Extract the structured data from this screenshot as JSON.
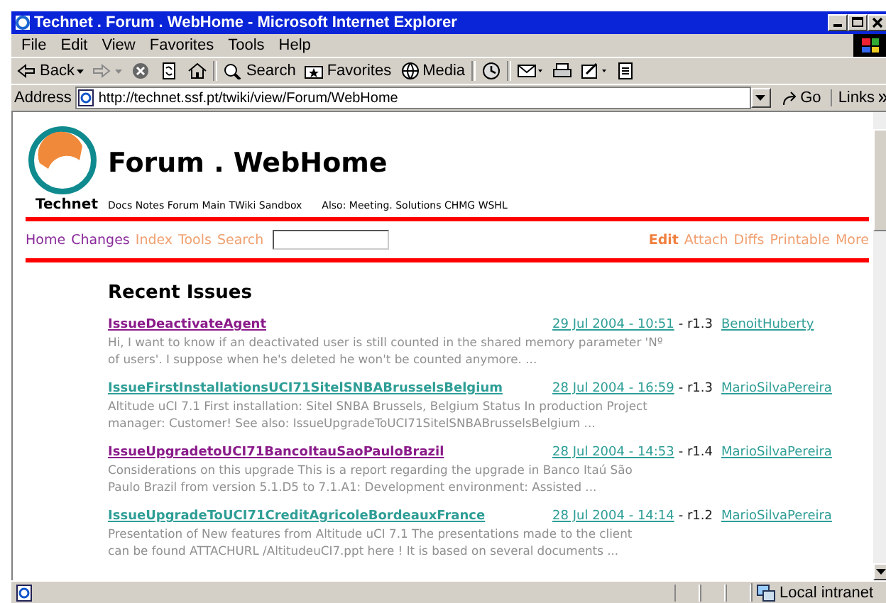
{
  "window": {
    "title": "Technet . Forum . WebHome - Microsoft Internet Explorer"
  },
  "menu": [
    "File",
    "Edit",
    "View",
    "Favorites",
    "Tools",
    "Help"
  ],
  "toolbar": [
    {
      "kind": "back",
      "label": "Back"
    },
    {
      "kind": "forward"
    },
    {
      "kind": "stop"
    },
    {
      "kind": "refresh"
    },
    {
      "kind": "home"
    },
    {
      "kind": "search",
      "label": "Search"
    },
    {
      "kind": "favorites",
      "label": "Favorites"
    },
    {
      "kind": "media",
      "label": "Media"
    },
    {
      "kind": "history"
    },
    {
      "kind": "mail"
    },
    {
      "kind": "print"
    },
    {
      "kind": "edit"
    },
    {
      "kind": "discuss"
    }
  ],
  "address_bar": {
    "label": "Address",
    "value": "http://technet.ssf.pt/twiki/view/Forum/WebHome",
    "go": "Go",
    "links": "Links"
  },
  "page": {
    "site": "Technet",
    "title": "Forum . WebHome",
    "webs": "Docs Notes Forum Main TWiki Sandbox",
    "also": "Also: Meeting. Solutions CHMG WSHL",
    "nav_left": [
      {
        "label": "Home",
        "visited": true
      },
      {
        "label": "Changes",
        "visited": true
      },
      {
        "label": "Index",
        "visited": false
      },
      {
        "label": "Tools",
        "visited": false
      },
      {
        "label": "Search",
        "visited": false
      }
    ],
    "nav_right": [
      {
        "label": "Edit",
        "bold": true
      },
      {
        "label": "Attach",
        "bold": false
      },
      {
        "label": "Diffs",
        "bold": false
      },
      {
        "label": "Printable",
        "bold": false
      },
      {
        "label": "More",
        "bold": false
      }
    ],
    "heading": "Recent Issues",
    "issues": [
      {
        "topic": "IssueDeactivateAgent",
        "visited": true,
        "date": "29 Jul 2004 - 10:51",
        "rev": "- r1.3",
        "author": "BenoitHuberty",
        "summary": [
          "Hi, I want to know if an deactivated user is still counted in the shared memory parameter 'Nº",
          "of users'. I suppose when he's deleted he won't be counted anymore. ..."
        ]
      },
      {
        "topic": "IssueFirstInstallationsUCI71SitelSNBABrusselsBelgium",
        "visited": false,
        "date": "28 Jul 2004 - 16:59",
        "rev": "- r1.3",
        "author": "MarioSilvaPereira",
        "summary": [
          "Altitude uCI 7.1 First installation: Sitel SNBA Brussels, Belgium Status In production Project",
          "manager: Customer! See also: IssueUpgradeToUCI71SitelSNBABrusselsBelgium ..."
        ]
      },
      {
        "topic": "IssueUpgradetoUCI71BancoItauSaoPauloBrazil",
        "visited": true,
        "date": "28 Jul 2004 - 14:53",
        "rev": "- r1.4",
        "author": "MarioSilvaPereira",
        "summary": [
          "Considerations on this upgrade This is a report regarding the upgrade in Banco Itaú São",
          "Paulo Brazil from version 5.1.D5 to 7.1.A1: Development environment: Assisted ..."
        ]
      },
      {
        "topic": "IssueUpgradeToUCI71CreditAgricoleBordeauxFrance",
        "visited": false,
        "date": "28 Jul 2004 - 14:14",
        "rev": "- r1.2",
        "author": "MarioSilvaPereira",
        "summary": [
          "Presentation of New features from Altitude uCI 7.1 The presentations made to the client",
          "can be found ATTACHURL /AltitudeuCI7.ppt here ! It is based on several documents ..."
        ]
      }
    ]
  },
  "status_bar": {
    "zone": "Local intranet"
  }
}
